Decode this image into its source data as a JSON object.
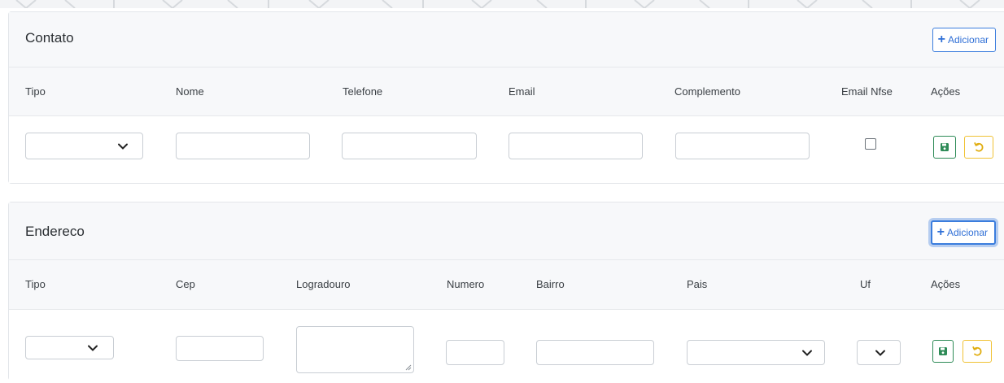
{
  "contato": {
    "title": "Contato",
    "add_label": "Adicionar",
    "columns": [
      "Tipo",
      "Nome",
      "Telefone",
      "Email",
      "Complemento",
      "Email Nfse",
      "Ações"
    ],
    "row": {
      "tipo": "",
      "nome": "",
      "telefone": "",
      "email": "",
      "complemento": "",
      "email_nfse": false
    }
  },
  "endereco": {
    "title": "Endereco",
    "add_label": "Adicionar",
    "columns": [
      "Tipo",
      "Cep",
      "Logradouro",
      "Numero",
      "Bairro",
      "Pais",
      "Uf",
      "Ações"
    ],
    "row": {
      "tipo": "",
      "cep": "",
      "logradouro": "",
      "numero": "",
      "bairro": "",
      "pais": "",
      "uf": ""
    }
  },
  "icons": {
    "add": "plus-icon",
    "save": "floppy-disk-icon",
    "undo": "undo-icon",
    "dropdown": "chevron-down-icon"
  },
  "colors": {
    "primary": "#2f6fd6",
    "save": "#2e8b57",
    "undo": "#f0c234",
    "header_bg": "#f7f8fa"
  }
}
